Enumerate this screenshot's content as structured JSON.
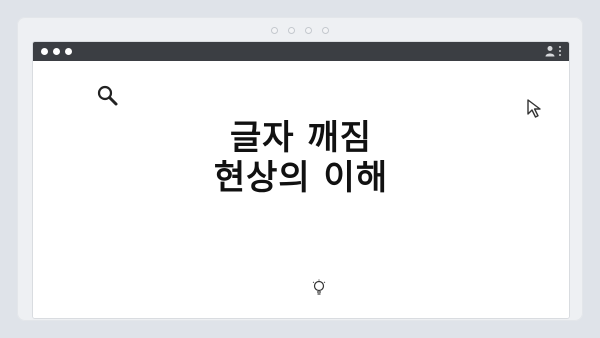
{
  "headline": {
    "line1": "글자 깨짐",
    "line2": "현상의 이해"
  },
  "icons": {
    "search": "search-icon",
    "cursor": "cursor-icon",
    "lightbulb": "lightbulb-icon",
    "user": "user-icon",
    "menu": "kebab-menu-icon"
  },
  "colors": {
    "background": "#dfe3e9",
    "frame": "#eef0f3",
    "titlebar": "#3b3e43",
    "text": "#111111"
  }
}
